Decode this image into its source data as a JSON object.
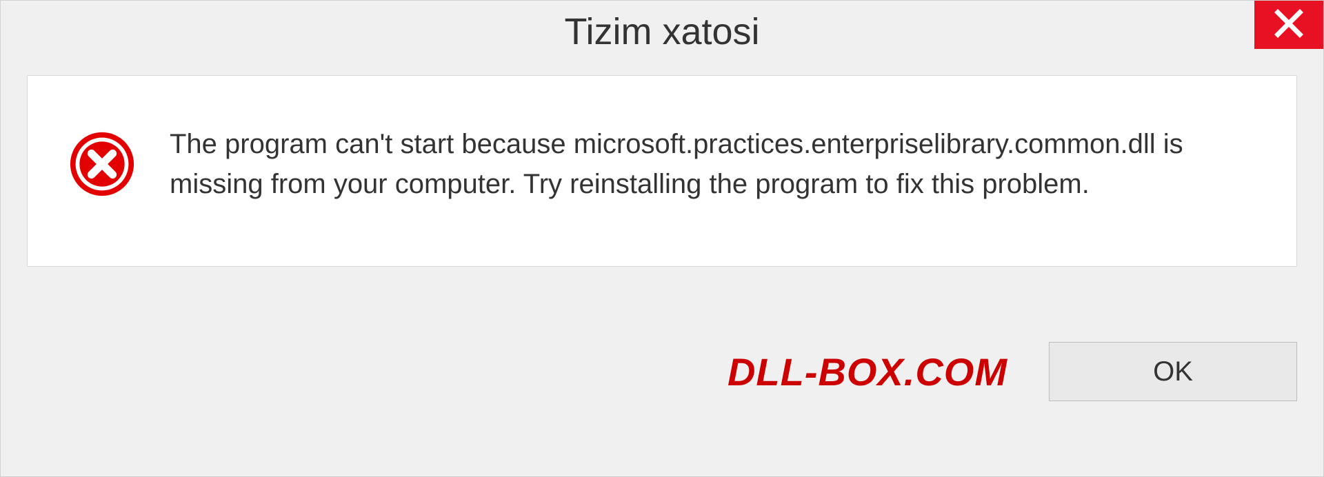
{
  "dialog": {
    "title": "Tizim xatosi",
    "message": "The program can't start because microsoft.practices.enterpriselibrary.common.dll is missing from your computer. Try reinstalling the program to fix this problem.",
    "ok_label": "OK"
  },
  "watermark": {
    "text": "DLL-BOX.COM"
  },
  "colors": {
    "close_bg": "#e81123",
    "error_red": "#e30000",
    "watermark_red": "#cc0000"
  }
}
